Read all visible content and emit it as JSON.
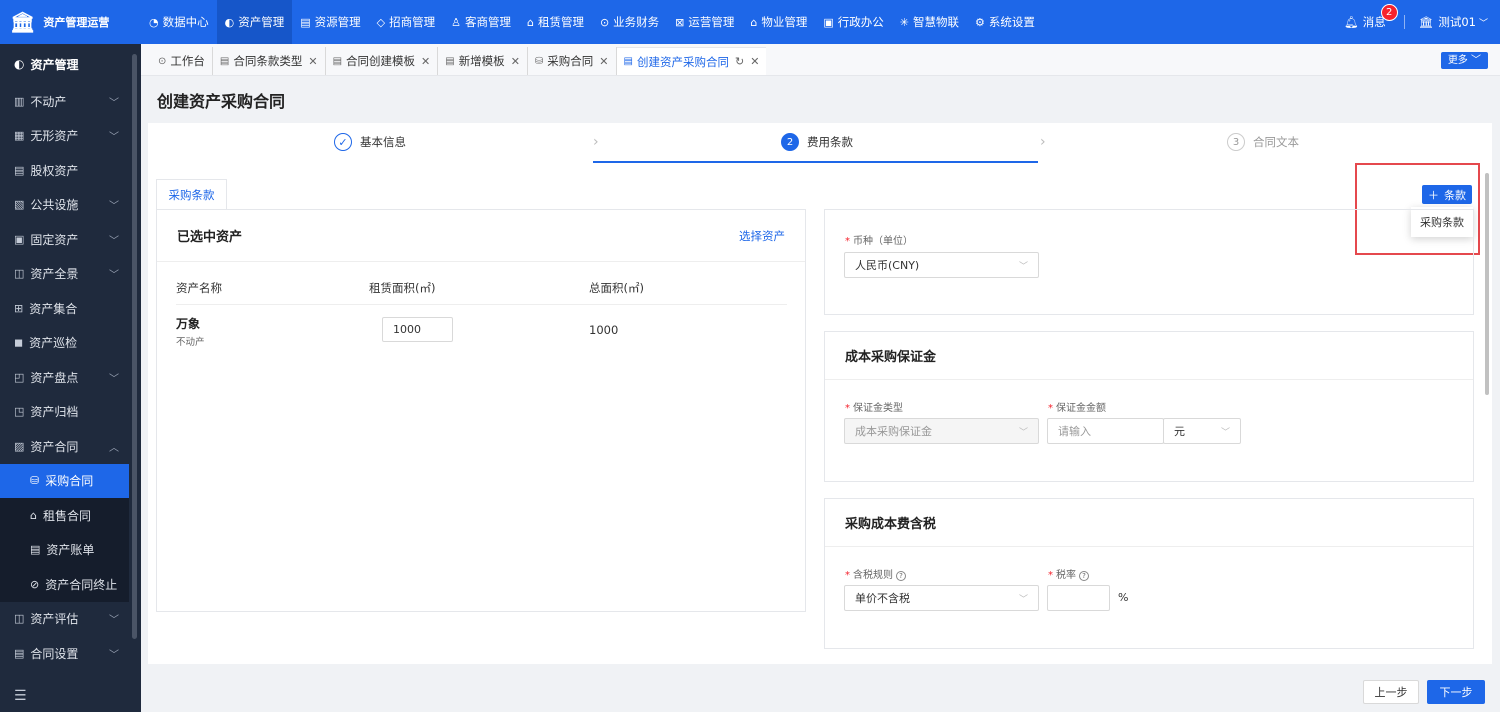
{
  "app": {
    "name": "资产管理运营"
  },
  "nav": [
    {
      "icon": "chart-icon",
      "label": "数据中心"
    },
    {
      "icon": "cube-icon",
      "label": "资产管理"
    },
    {
      "icon": "resource-icon",
      "label": "资源管理"
    },
    {
      "icon": "tag-icon",
      "label": "招商管理"
    },
    {
      "icon": "people-icon",
      "label": "客商管理"
    },
    {
      "icon": "home-icon",
      "label": "租赁管理"
    },
    {
      "icon": "coin-icon",
      "label": "业务财务"
    },
    {
      "icon": "ops-icon",
      "label": "运营管理"
    },
    {
      "icon": "building-icon",
      "label": "物业管理"
    },
    {
      "icon": "office-icon",
      "label": "行政办公"
    },
    {
      "icon": "iot-icon",
      "label": "智慧物联"
    },
    {
      "icon": "gear-icon",
      "label": "系统设置"
    }
  ],
  "top_right": {
    "messages_label": "消息",
    "messages_count": "2",
    "user_label": "测试01"
  },
  "sidebar": {
    "header": "资产管理",
    "items": [
      {
        "label": "不动产",
        "arrow": "﹀"
      },
      {
        "label": "无形资产",
        "arrow": "﹀"
      },
      {
        "label": "股权资产",
        "arrow": ""
      },
      {
        "label": "公共设施",
        "arrow": "﹀"
      },
      {
        "label": "固定资产",
        "arrow": "﹀"
      },
      {
        "label": "资产全景",
        "arrow": "﹀"
      },
      {
        "label": "资产集合",
        "arrow": ""
      },
      {
        "label": "资产巡检",
        "arrow": ""
      },
      {
        "label": "资产盘点",
        "arrow": "﹀"
      },
      {
        "label": "资产归档",
        "arrow": ""
      },
      {
        "label": "资产合同",
        "arrow": "︿"
      }
    ],
    "subitems": [
      "采购合同",
      "租售合同",
      "资产账单",
      "资产合同终止"
    ],
    "items_after": [
      {
        "label": "资产评估",
        "arrow": "﹀"
      },
      {
        "label": "合同设置",
        "arrow": "﹀"
      }
    ]
  },
  "tabs": [
    {
      "label": "工作台",
      "closable": false
    },
    {
      "label": "合同条款类型",
      "closable": true
    },
    {
      "label": "合同创建模板",
      "closable": true
    },
    {
      "label": "新增模板",
      "closable": true
    },
    {
      "label": "采购合同",
      "closable": true
    },
    {
      "label": "创建资产采购合同",
      "closable": true
    }
  ],
  "more_label": "更多 ﹀",
  "page_title": "创建资产采购合同",
  "steps": [
    {
      "index": "✓",
      "label": "基本信息",
      "state": "done"
    },
    {
      "index": "2",
      "label": "费用条款",
      "state": "current"
    },
    {
      "index": "3",
      "label": "合同文本",
      "state": "todo"
    }
  ],
  "subtab_label": "采购条款",
  "add_clause_label": "条款",
  "dropdown_option": "采购条款",
  "left_panel": {
    "title": "已选中资产",
    "select_link": "选择资产",
    "columns": [
      "资产名称",
      "租赁面积(㎡)",
      "总面积(㎡)"
    ],
    "rows": [
      {
        "name": "万象",
        "type": "不动产",
        "rent_area": "1000",
        "total_area": "1000"
      }
    ]
  },
  "currency": {
    "label": "币种（单位）",
    "value": "人民币(CNY)"
  },
  "deposit": {
    "title": "成本采购保证金",
    "type_label": "保证金类型",
    "type_value": "成本采购保证金",
    "amount_label": "保证金金额",
    "amount_placeholder": "请输入",
    "unit": "元"
  },
  "tax": {
    "title": "采购成本费含税",
    "rule_label": "含税规则",
    "rule_value": "单价不含税",
    "rate_label": "税率",
    "rate_unit": "%"
  },
  "buttons": {
    "prev": "上一步",
    "next": "下一步"
  },
  "colors": {
    "primary": "#1e67e8",
    "sidebar": "#1f2a3d",
    "highlight": "#e5484d"
  }
}
